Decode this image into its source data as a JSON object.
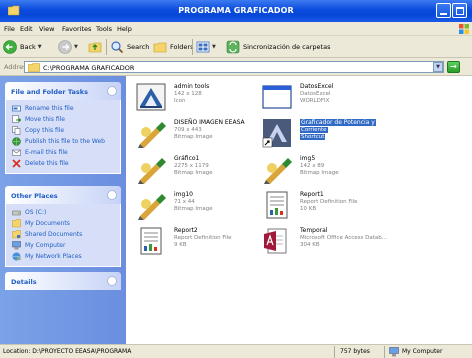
{
  "window": {
    "title": "PROGRAMA GRAFICADOR"
  },
  "menu": [
    "File",
    "Edit",
    "View",
    "Favorites",
    "Tools",
    "Help"
  ],
  "toolbar": {
    "back": "Back",
    "search": "Search",
    "folders": "Folders",
    "sync": "Sincronización de carpetas"
  },
  "address": {
    "label": "Address",
    "path": "C:\\PROGRAMA GRAFICADOR"
  },
  "sidebar": {
    "file_tasks": {
      "title": "File and Folder Tasks",
      "items": [
        {
          "label": "Rename this file",
          "icon": "rename-icon"
        },
        {
          "label": "Move this file",
          "icon": "move-icon"
        },
        {
          "label": "Copy this file",
          "icon": "copy-icon"
        },
        {
          "label": "Publish this file to the Web",
          "icon": "publish-icon"
        },
        {
          "label": "E-mail this file",
          "icon": "email-icon"
        },
        {
          "label": "Delete this file",
          "icon": "delete-icon"
        }
      ]
    },
    "other_places": {
      "title": "Other Places",
      "items": [
        {
          "label": "OS (C:)",
          "icon": "drive-icon"
        },
        {
          "label": "My Documents",
          "icon": "my-documents-icon"
        },
        {
          "label": "Shared Documents",
          "icon": "shared-documents-icon"
        },
        {
          "label": "My Computer",
          "icon": "my-computer-icon"
        },
        {
          "label": "My Network Places",
          "icon": "network-places-icon"
        }
      ]
    },
    "details": {
      "title": "Details"
    }
  },
  "files": [
    {
      "name": "admin tools",
      "line2": "142 x 128",
      "line3": "Icon",
      "icon": "admin-tools-icon"
    },
    {
      "name": "DatosExcel",
      "line2": "DatosExcel",
      "line3": "WORLDFIX",
      "icon": "window-file-icon"
    },
    {
      "name": "DISEÑO IMAGEN EEASA",
      "line2": "709 x 443",
      "line3": "Bitmap Image",
      "icon": "bitmap-icon"
    },
    {
      "name": "Graficador de Potencia y",
      "line2": "Corriente",
      "line3": "Shortcut",
      "icon": "shortcut-icon",
      "selected": true
    },
    {
      "name": "Gráfico1",
      "line2": "2275 x 1179",
      "line3": "Bitmap Image",
      "icon": "bitmap-icon"
    },
    {
      "name": "img5",
      "line2": "142 x 89",
      "line3": "Bitmap Image",
      "icon": "bitmap-icon"
    },
    {
      "name": "img10",
      "line2": "71 x 44",
      "line3": "Bitmap Image",
      "icon": "bitmap-icon"
    },
    {
      "name": "Report1",
      "line2": "Report Definition File",
      "line3": "10 KB",
      "icon": "report-icon"
    },
    {
      "name": "Report2",
      "line2": "Report Definition File",
      "line3": "9 KB",
      "icon": "report-icon"
    },
    {
      "name": "Temporal",
      "line2": "Microsoft Office Access Datab...",
      "line3": "304 KB",
      "icon": "access-db-icon"
    }
  ],
  "status": {
    "location": "Location: D:\\PROYECTO  EEASA\\PROGRAMA",
    "size": "757 bytes",
    "zone": "My Computer"
  },
  "colors": {
    "title_blue": "#0a4bdc",
    "sidebar_blue": "#7ba2e7",
    "link_blue": "#215dc6",
    "selection": "#316ac5"
  }
}
